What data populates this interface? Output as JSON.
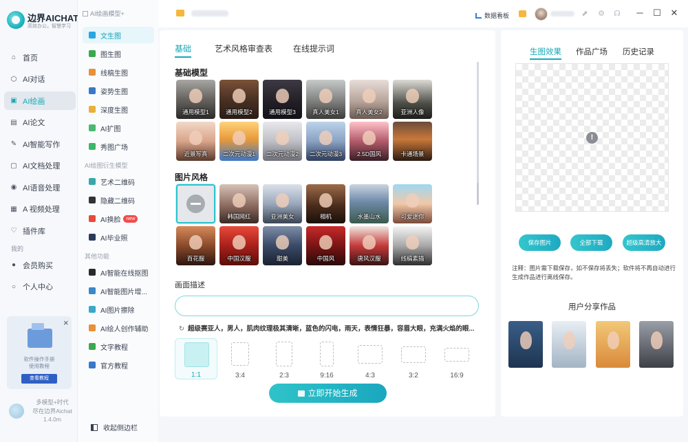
{
  "app": {
    "name": "边界AICHAT",
    "tagline": "高效办公，智慧学习"
  },
  "sidebar": {
    "items": [
      {
        "label": "首页",
        "icon": "home-icon"
      },
      {
        "label": "AI对话",
        "icon": "cube-icon"
      },
      {
        "label": "AI绘画",
        "icon": "paint-icon",
        "active": true
      },
      {
        "label": "AI论文",
        "icon": "doc-icon"
      },
      {
        "label": "AI智能写作",
        "icon": "pen-icon"
      },
      {
        "label": "AI文档处理",
        "icon": "file-ai-icon"
      },
      {
        "label": "AI语音处理",
        "icon": "voice-icon"
      },
      {
        "label": "A 视频处理",
        "icon": "video-icon"
      },
      {
        "label": "插件库",
        "icon": "plugin-icon"
      }
    ],
    "mine_label": "我的",
    "mine_items": [
      {
        "label": "会员购买",
        "icon": "user-icon"
      },
      {
        "label": "个人中心",
        "icon": "person-icon"
      }
    ],
    "promo": {
      "text_line1": "软件操作手册",
      "text_line2": "使用教程",
      "button": "查看教程",
      "close": "×"
    },
    "version_lines": [
      "多模型+时代",
      "尽在边界Aichat",
      "1.4.0m"
    ]
  },
  "subnav": {
    "header": "AI绘画模型+",
    "items": [
      {
        "label": "文生图",
        "color": "#2aa5e0",
        "active": true
      },
      {
        "label": "图生图",
        "color": "#3aa84c"
      },
      {
        "label": "线稿生图",
        "color": "#e8903a"
      },
      {
        "label": "姿势生图",
        "color": "#3a78c8"
      },
      {
        "label": "深度生图",
        "color": "#e8b03a"
      },
      {
        "label": "AI扩图",
        "color": "#4ab870"
      },
      {
        "label": "秀图广场",
        "color": "#3ab86a"
      }
    ],
    "group2": "AI绘图衍生模型",
    "items2": [
      {
        "label": "艺术二维码",
        "color": "#3aa8a8"
      },
      {
        "label": "隐藏二维码",
        "color": "#333333"
      },
      {
        "label": "AI换脸",
        "color": "#e84a3a",
        "badge": "new"
      },
      {
        "label": "AI毕业照",
        "color": "#2a3a5a"
      }
    ],
    "group3": "其他功能",
    "items3": [
      {
        "label": "AI智能在线抠图",
        "color": "#2a2a2a"
      },
      {
        "label": "AI智能图片增...",
        "color": "#3a88c8"
      },
      {
        "label": "AI图片擦除",
        "color": "#3aa8c8"
      },
      {
        "label": "AI绘人创作辅助",
        "color": "#e8903a"
      },
      {
        "label": "文字教程",
        "color": "#3aa84c"
      },
      {
        "label": "官方教程",
        "color": "#3a78c8"
      }
    ],
    "collapse": "收起侧边栏"
  },
  "titlebar": {
    "dashboard": "数据看板"
  },
  "main": {
    "tabs": [
      {
        "label": "基础",
        "active": true
      },
      {
        "label": "艺术风格审查表"
      },
      {
        "label": "在线提示词"
      }
    ],
    "base_title": "基础模型",
    "base_models": [
      "通用模型1",
      "通用模型2",
      "通用模型3",
      "真人美女1",
      "真人美女2",
      "亚洲人像",
      "近景写真",
      "二次元动漫1",
      "二次元动漫2",
      "二次元动漫3",
      "2.5D国风",
      "卡通场景"
    ],
    "style_title": "图片风格",
    "styles": [
      "",
      "韩国网红",
      "亚洲美女",
      "相机",
      "水墨山水",
      "可爱迷你",
      "百花服",
      "中国汉服",
      "甜美",
      "中国风",
      "唐风汉服",
      "线稿素描"
    ],
    "desc_label": "画面描述",
    "desc_value": "",
    "prompt_suggestion": "超级赛亚人，男人，肌肉纹理极其清晰，蓝色的闪电，雨天，表情狂暴，容眉大眼，充满火焰的眼...",
    "ratios": [
      "1:1",
      "3:4",
      "2:3",
      "9:16",
      "4:3",
      "3:2",
      "16:9"
    ],
    "generate": "立即开始生成"
  },
  "right": {
    "tabs": [
      {
        "label": "生图效果",
        "active": true
      },
      {
        "label": "作品广场"
      },
      {
        "label": "历史记录"
      }
    ],
    "buttons": [
      "保存图片",
      "全部下载",
      "超级高清放大"
    ],
    "note": "注释：图片需下载保存，如不保存将丢失；软件将不再自动进行生成作品进行离线保存。",
    "share_title": "用户分享作品"
  },
  "colors": {
    "accent": "#15a9b6",
    "badge_new": "#f24c4c"
  }
}
